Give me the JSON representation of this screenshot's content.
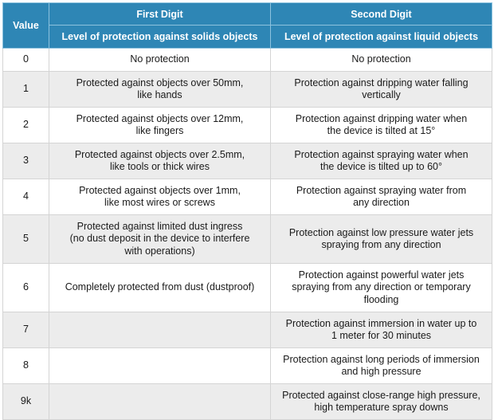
{
  "header": {
    "value_label": "Value",
    "first_digit": {
      "title": "First Digit",
      "subtitle": "Level of protection against solids objects"
    },
    "second_digit": {
      "title": "Second Digit",
      "subtitle": "Level of protection against liquid objects"
    }
  },
  "colors": {
    "header_bg": "#2e86b5",
    "header_divider": "#8cc2de",
    "row_alt_bg": "#ececec",
    "row_bg": "#ffffff",
    "grid": "#d4d4d4"
  },
  "rows": [
    {
      "value": "0",
      "first": "No protection",
      "second": "No protection"
    },
    {
      "value": "1",
      "first": "Protected against objects over 50mm,\nlike hands",
      "second": "Protection against dripping water falling\nvertically"
    },
    {
      "value": "2",
      "first": "Protected against objects over 12mm,\nlike fingers",
      "second": "Protection against dripping water when\nthe device is tilted at 15°"
    },
    {
      "value": "3",
      "first": "Protected against objects over 2.5mm,\nlike tools or thick wires",
      "second": "Protection against spraying water when\nthe device is tilted up to 60°"
    },
    {
      "value": "4",
      "first": "Protected against objects over 1mm,\nlike most wires or screws",
      "second": "Protection against spraying water from\nany direction"
    },
    {
      "value": "5",
      "first": "Protected against limited dust ingress\n(no dust deposit in the device to interfere\nwith operations)",
      "second": "Protection against low pressure water jets\nspraying from any direction"
    },
    {
      "value": "6",
      "first": "Completely protected from dust (dustproof)",
      "second": "Protection against powerful water jets\nspraying from any direction or temporary\nflooding"
    },
    {
      "value": "7",
      "first": "",
      "second": "Protection against immersion in water up to\n1 meter for 30 minutes"
    },
    {
      "value": "8",
      "first": "",
      "second": "Protection against long periods of immersion\nand high pressure"
    },
    {
      "value": "9k",
      "first": "",
      "second": "Protected against close-range high pressure,\nhigh temperature spray downs"
    }
  ]
}
